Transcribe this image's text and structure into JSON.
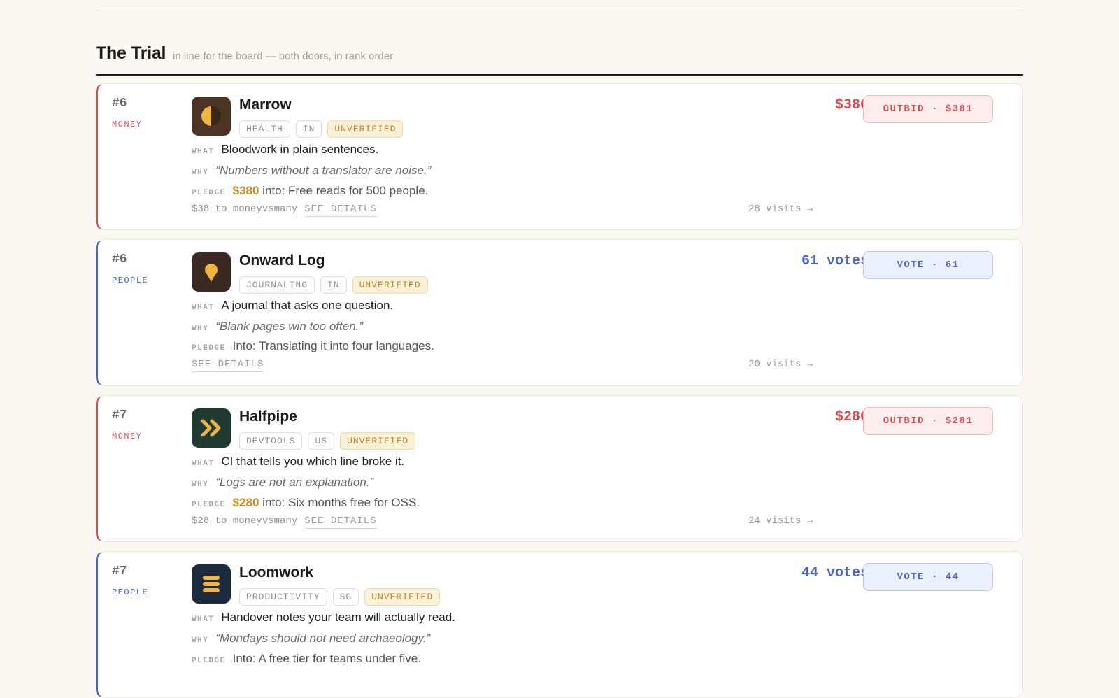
{
  "section": {
    "title": "The Trial",
    "subtitle": "in line for the board — both doors, in rank order"
  },
  "labels": {
    "what": "WHAT",
    "why": "WHY",
    "pledge": "PLEDGE",
    "see_details": "SEE DETAILS"
  },
  "colors": {
    "money": "#d94a4f",
    "people": "#4a63cf",
    "pledge_amount": "#c98a22",
    "unverified": "#b8862b"
  },
  "entries": [
    {
      "rank": "#6",
      "door": "MONEY",
      "name": "Marrow",
      "logo_icon": "half-moon-icon",
      "tags": [
        "HEALTH",
        "IN",
        "UNVERIFIED"
      ],
      "what": "Bloodwork in plain sentences.",
      "why": "“Numbers without a translator are noise.”",
      "pledge_amount": "$380",
      "pledge_text": "into: Free reads for 500 people.",
      "fee": "$38 to moneyvsmany",
      "visits": "28 visits →",
      "amount": "$380",
      "action": "OUTBID · $381"
    },
    {
      "rank": "#6",
      "door": "PEOPLE",
      "name": "Onward Log",
      "logo_icon": "map-pin-icon",
      "tags": [
        "JOURNALING",
        "IN",
        "UNVERIFIED"
      ],
      "what": "A journal that asks one question.",
      "why": "“Blank pages win too often.”",
      "pledge_text": "Into: Translating it into four languages.",
      "visits": "20 visits →",
      "amount": "61 votes",
      "action": "VOTE · 61"
    },
    {
      "rank": "#7",
      "door": "MONEY",
      "name": "Halfpipe",
      "logo_icon": "double-chevron-icon",
      "tags": [
        "DEVTOOLS",
        "US",
        "UNVERIFIED"
      ],
      "what": "CI that tells you which line broke it.",
      "why": "“Logs are not an explanation.”",
      "pledge_amount": "$280",
      "pledge_text": "into: Six months free for OSS.",
      "fee": "$28 to moneyvsmany",
      "visits": "24 visits →",
      "amount": "$280",
      "action": "OUTBID · $281"
    },
    {
      "rank": "#7",
      "door": "PEOPLE",
      "name": "Loomwork",
      "logo_icon": "stack-lines-icon",
      "tags": [
        "PRODUCTIVITY",
        "SG",
        "UNVERIFIED"
      ],
      "what": "Handover notes your team will actually read.",
      "why": "“Mondays should not need archaeology.”",
      "pledge_text": "Into: A free tier for teams under five.",
      "amount": "44 votes",
      "action": "VOTE · 44"
    }
  ]
}
